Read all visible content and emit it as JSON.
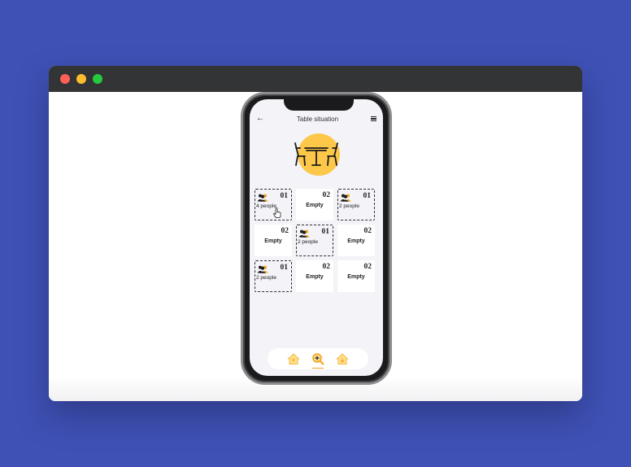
{
  "colors": {
    "background": "#3f51b5",
    "titlebar": "#333436",
    "close": "#ff5f56",
    "minimize": "#ffbd2e",
    "maximize": "#27c93f",
    "accent": "#fdc84a"
  },
  "app": {
    "title": "Table situation",
    "back_icon": "arrow-left-icon",
    "menu_icon": "hamburger-menu-icon",
    "hero_icon": "dining-table-chairs-icon"
  },
  "tables": [
    {
      "number": "01",
      "status": "occupied",
      "text": "4 people"
    },
    {
      "number": "02",
      "status": "empty",
      "text": "Empty"
    },
    {
      "number": "01",
      "status": "occupied",
      "text": "2 people"
    },
    {
      "number": "02",
      "status": "empty",
      "text": "Empty"
    },
    {
      "number": "01",
      "status": "occupied",
      "text": "2 people"
    },
    {
      "number": "02",
      "status": "empty",
      "text": "Empty"
    },
    {
      "number": "01",
      "status": "occupied",
      "text": "2 people"
    },
    {
      "number": "02",
      "status": "empty",
      "text": "Empty"
    },
    {
      "number": "02",
      "status": "empty",
      "text": "Empty"
    }
  ],
  "bottom_nav": [
    {
      "icon": "home-icon",
      "active": false
    },
    {
      "icon": "search-add-icon",
      "active": true
    },
    {
      "icon": "home-icon",
      "active": false
    }
  ]
}
